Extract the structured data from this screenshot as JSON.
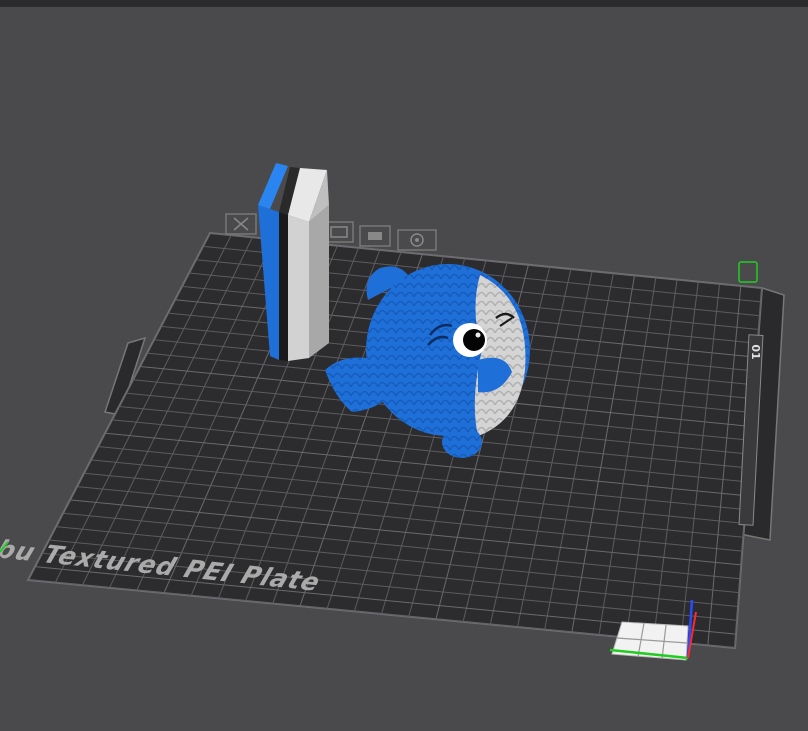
{
  "plate": {
    "name_label": "Bambu Textured PEI Plate",
    "plate_number": "01"
  },
  "colors": {
    "background": "#4a4a4c",
    "plate": "#2c2c2e",
    "grid": "#5c5c60",
    "model_blue": "#1e6fd8",
    "model_white": "#d4d4d4",
    "tower_black": "#1a1a1a",
    "axis_x": "#ff2a2a",
    "axis_y": "#22cc22",
    "axis_z": "#2a4cff"
  },
  "toolbar_icons": [
    "close-icon",
    "arrange-icon",
    "orient-icon",
    "lock-icon",
    "settings-icon"
  ],
  "objects": [
    "prime-tower",
    "shark-plush-model"
  ]
}
